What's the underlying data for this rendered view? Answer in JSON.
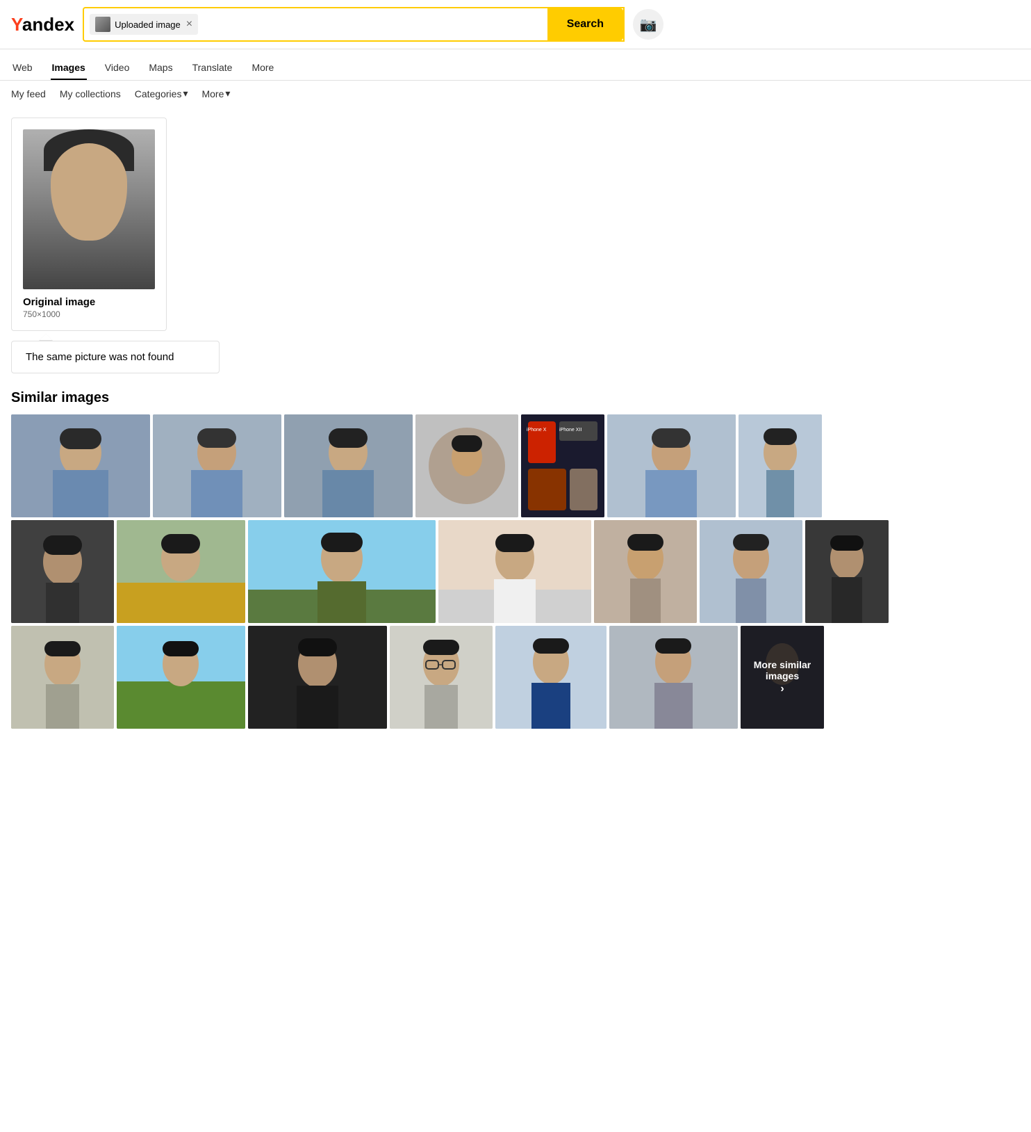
{
  "logo": {
    "prefix": "Y",
    "suffix": "andex"
  },
  "search": {
    "uploaded_label": "Uploaded image",
    "placeholder": "",
    "button_label": "Search"
  },
  "nav": {
    "tabs": [
      {
        "id": "web",
        "label": "Web",
        "active": false
      },
      {
        "id": "images",
        "label": "Images",
        "active": true
      },
      {
        "id": "video",
        "label": "Video",
        "active": false
      },
      {
        "id": "maps",
        "label": "Maps",
        "active": false
      },
      {
        "id": "translate",
        "label": "Translate",
        "active": false
      },
      {
        "id": "more",
        "label": "More",
        "active": false
      }
    ]
  },
  "subnav": {
    "items": [
      {
        "id": "my-feed",
        "label": "My feed"
      },
      {
        "id": "my-collections",
        "label": "My collections"
      },
      {
        "id": "categories",
        "label": "Categories",
        "has_arrow": true
      },
      {
        "id": "more",
        "label": "More",
        "has_arrow": true
      }
    ]
  },
  "original": {
    "label": "Original image",
    "size": "750×1000"
  },
  "not_found": {
    "text": "The same picture was not found"
  },
  "similar": {
    "heading": "Similar images",
    "more_label": "More similar images"
  }
}
